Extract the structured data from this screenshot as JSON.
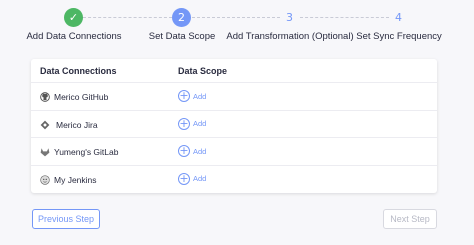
{
  "steps": [
    {
      "number": "✓",
      "label": "Add Data Connections",
      "state": "done"
    },
    {
      "number": "2",
      "label": "Set Data Scope",
      "state": "active"
    },
    {
      "number": "3",
      "label": "Add Transformation (Optional)",
      "state": "pending"
    },
    {
      "number": "4",
      "label": "Set Sync Frequency",
      "state": "pending"
    }
  ],
  "table": {
    "headers": {
      "connections": "Data Connections",
      "scope": "Data Scope"
    },
    "rows": [
      {
        "name": "Merico GitHub",
        "icon": "github-icon",
        "add_label": "Add"
      },
      {
        "name": "Merico Jira",
        "icon": "jira-icon",
        "add_label": "Add"
      },
      {
        "name": "Yumeng's GitLab",
        "icon": "gitlab-icon",
        "add_label": "Add"
      },
      {
        "name": "My Jenkins",
        "icon": "jenkins-icon",
        "add_label": "Add"
      }
    ]
  },
  "buttons": {
    "prev": "Previous Step",
    "next": "Next Step"
  },
  "colors": {
    "primary": "#7497f7",
    "success": "#4db764",
    "text": "#292b3f",
    "disabled": "#b7b9c5"
  }
}
